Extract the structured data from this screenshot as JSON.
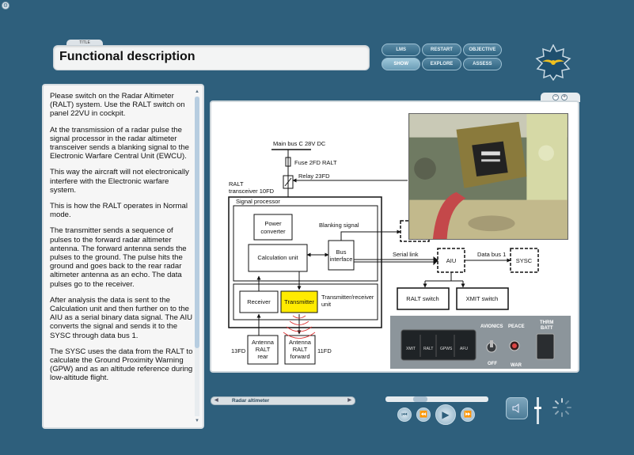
{
  "header": {
    "title_tag": "TITLE",
    "title": "Functional description"
  },
  "nav": {
    "buttons": [
      {
        "label": "LMS",
        "active": false
      },
      {
        "label": "RESTART",
        "active": false
      },
      {
        "label": "OBJECTIVE",
        "active": false
      },
      {
        "label": "SHOW",
        "active": true
      },
      {
        "label": "EXPLORE",
        "active": false
      },
      {
        "label": "ASSESS",
        "active": false
      }
    ]
  },
  "text_panel": {
    "paragraphs": [
      "Please switch on the Radar Altimeter (RALT) system. Use the RALT switch on panel 22VU in cockpit.",
      "At the transmission of a radar pulse the signal processor in the radar altimeter transceiver sends a blanking signal to the Electronic Warfare Central Unit (EWCU).",
      "This way the aircraft will not electronically interfere with the Electronic warfare system.",
      "This is how the RALT operates in Normal mode.",
      "The transmitter sends a sequence of pulses to the forward radar altimeter antenna. The forward antenna sends the pulses to the ground. The pulse hits the ground and goes back to the rear radar altimeter antenna as an echo. The data pulses go to the receiver.",
      "After analysis the data is sent to the Calculation unit and then further on to the AIU as a serial binary data signal. The AIU converts the signal and sends it to the SYSC through data bus 1.",
      "The SYSC uses the data from the RALT to calculate the Ground Proximity Warning (GPW) and as an altitude reference during low-altitude flight."
    ]
  },
  "diagram": {
    "main_bus": "Main bus C 28V DC",
    "fuse": "Fuse 2FD RALT",
    "relay": "Relay 23FD",
    "transceiver_line1": "RALT",
    "transceiver_line2": "transceiver 10FD",
    "signal_processor": "Signal processor",
    "power_line1": "Power",
    "power_line2": "converter",
    "blanking": "Blanking signal",
    "calc_unit": "Calculation unit",
    "bus_line1": "Bus",
    "bus_line2": "interface",
    "serial_link": "Serial link",
    "aiu": "AIU",
    "data_bus": "Data bus 1",
    "sysc": "SYSC",
    "receiver": "Receiver",
    "transmitter": "Transmitter",
    "tr_unit_line1": "Transmitter/receiver",
    "tr_unit_line2": "unit",
    "ralt_switch": "RALT switch",
    "xmit_switch": "XMIT switch",
    "ant_rear_id": "13FD",
    "ant_rear_line1": "Antenna",
    "ant_rear_line2": "RALT",
    "ant_rear_line3": "rear",
    "ant_fwd_line1": "Antenna",
    "ant_fwd_line2": "RALT",
    "ant_fwd_line3": "forward",
    "ant_fwd_id": "11FD",
    "highlight_color": "#ffeb00"
  },
  "control_panel": {
    "avionics": "AVIONICS",
    "peace": "PEACE",
    "thrm_line1": "THRM",
    "thrm_line2": "BATT",
    "off": "OFF",
    "war": "WAR",
    "tb": "TB",
    "switches": [
      "XMIT",
      "RALT",
      "GPWS",
      "AFU"
    ]
  },
  "player": {
    "chapter": "Radar altimeter",
    "seek_fraction": 0.31,
    "volume_fraction": 0.6
  }
}
